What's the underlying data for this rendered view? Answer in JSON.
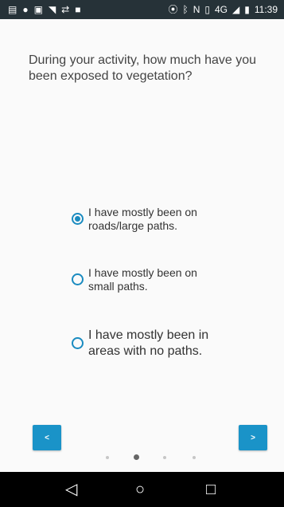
{
  "status_bar": {
    "time": "11:39",
    "network": "4G",
    "icons_left": [
      "notification-icon",
      "circle-icon",
      "image-icon",
      "wifi-icon",
      "sync-icon",
      "square-icon"
    ],
    "icons_right": [
      "location-icon",
      "bluetooth-icon",
      "nfc-icon",
      "vibrate-icon",
      "signal-icon",
      "battery-icon"
    ]
  },
  "question": "During your activity, how much have you been exposed to vegetation?",
  "options": [
    {
      "label": "I have mostly been on roads/large paths.",
      "selected": true
    },
    {
      "label": "I have mostly been on small paths.",
      "selected": false
    },
    {
      "label": "I have mostly been in areas with no paths.",
      "selected": false
    }
  ],
  "navigation": {
    "prev_label": "<",
    "next_label": ">"
  },
  "pager": {
    "total": 4,
    "active": 2
  },
  "system_nav": {
    "back_icon": "◁",
    "home_icon": "○",
    "recent_icon": "□"
  },
  "colors": {
    "accent": "#1a93c8",
    "status_bar": "#263238",
    "background": "#fafafa"
  }
}
